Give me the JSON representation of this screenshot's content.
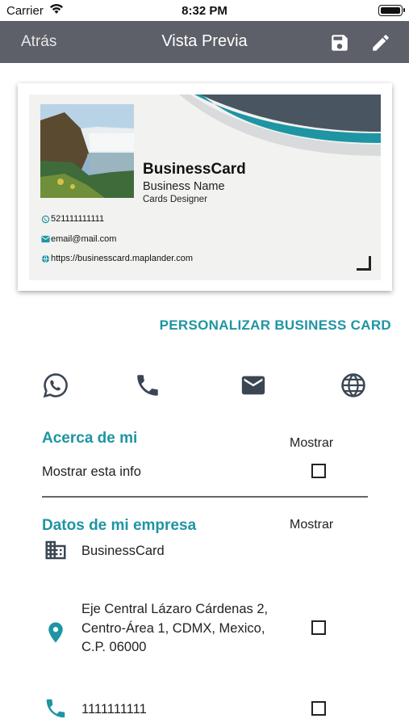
{
  "status_bar": {
    "carrier": "Carrier",
    "time": "8:32 PM"
  },
  "nav": {
    "back_label": "Atrás",
    "title": "Vista Previa"
  },
  "card": {
    "name": "BusinessCard",
    "business_name": "Business Name",
    "role": "Cards Designer",
    "phone": "521111111111",
    "email": "email@mail.com",
    "website": "https://businesscard.maplander.com"
  },
  "customize_label": "PERSONALIZAR BUSINESS CARD",
  "contact_icons": [
    "whatsapp-icon",
    "phone-icon",
    "mail-icon",
    "globe-icon"
  ],
  "about": {
    "title": "Acerca de mi",
    "show_label": "Mostrar",
    "row_label": "Mostrar esta info",
    "checked": false
  },
  "company": {
    "title": "Datos de mi empresa",
    "show_label": "Mostrar",
    "name": "BusinessCard",
    "address_line1": "Eje Central Lázaro Cárdenas 2,",
    "address_line2": "Centro-Área 1, CDMX, Mexico,",
    "address_line3": "C.P. 06000",
    "phone": "1111111111",
    "address_checked": false,
    "phone_checked": false
  },
  "colors": {
    "nav_bg": "#5d6068",
    "accent": "#1e95a3",
    "icon_dark": "#3b4654"
  }
}
